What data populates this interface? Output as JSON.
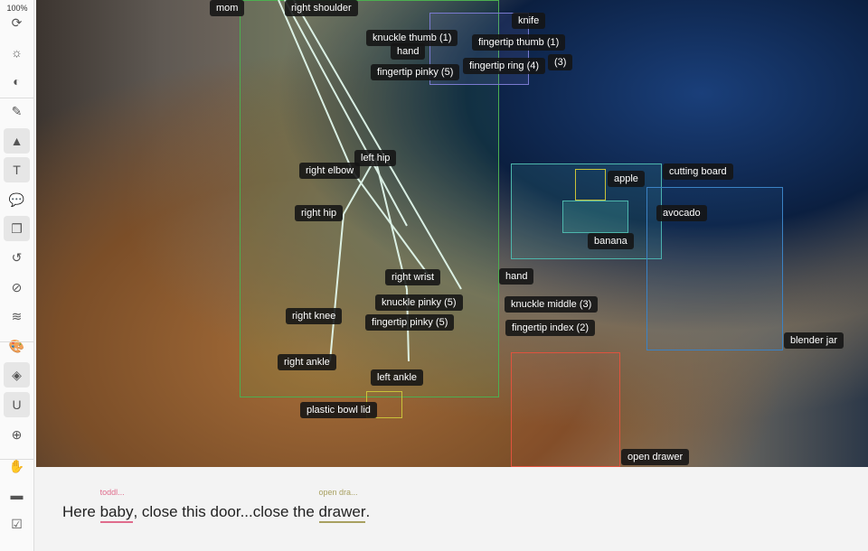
{
  "toolbar": {
    "zoom": "100%",
    "tools": [
      {
        "name": "refresh-icon",
        "glyph": "⟳"
      },
      {
        "name": "brightness-icon",
        "glyph": "☼"
      },
      {
        "name": "contrast-icon",
        "glyph": "◐"
      },
      {
        "name": "brush-icon",
        "glyph": "✎"
      },
      {
        "name": "shapes-icon",
        "glyph": "▲"
      },
      {
        "name": "text-icon",
        "glyph": "T"
      },
      {
        "name": "comments-icon",
        "glyph": "💬"
      },
      {
        "name": "layers-copy-icon",
        "glyph": "❐"
      },
      {
        "name": "history-icon",
        "glyph": "↺"
      },
      {
        "name": "hide-icon",
        "glyph": "⊘"
      },
      {
        "name": "layers-icon",
        "glyph": "≋"
      },
      {
        "name": "palette-icon",
        "glyph": "🎨"
      },
      {
        "name": "fill-off-icon",
        "glyph": "◈"
      },
      {
        "name": "magnet-icon",
        "glyph": "U"
      },
      {
        "name": "crosshair-icon",
        "glyph": "⊕"
      },
      {
        "name": "hand-icon",
        "glyph": "✋"
      },
      {
        "name": "ruler-icon",
        "glyph": "▬"
      },
      {
        "name": "checkbox-icon",
        "glyph": "☑"
      }
    ]
  },
  "labels": [
    "mom",
    "right shoulder",
    "knife",
    "knuckle thumb (1)",
    "fingertip thumb (1)",
    "hand",
    "fingertip pinky (5)",
    "fingertip ring (4)",
    "(3)",
    "left hip",
    "right elbow",
    "right hip",
    "apple",
    "cutting board",
    "avocado",
    "banana",
    "right wrist",
    "hand",
    "knuckle pinky (5)",
    "knuckle middle (3)",
    "fingertip pinky (5)",
    "fingertip index (2)",
    "right knee",
    "blender jar",
    "right ankle",
    "left ankle",
    "plastic bowl lid",
    "open drawer"
  ],
  "caption": {
    "before": "Here ",
    "e1": "baby",
    "e1_tag": "toddl...",
    "mid": ", close this door...close the ",
    "e2": "drawer",
    "e2_tag": "open dra...",
    "after": "."
  },
  "colors": {
    "person": "#4caf50",
    "cutting_board": "#4db6ac",
    "blender": "#3b82c4",
    "drawer": "#e0533e",
    "lid": "#c9c23a",
    "baby_tag": "#e06c8c",
    "drawer_tag": "#a8a060"
  }
}
